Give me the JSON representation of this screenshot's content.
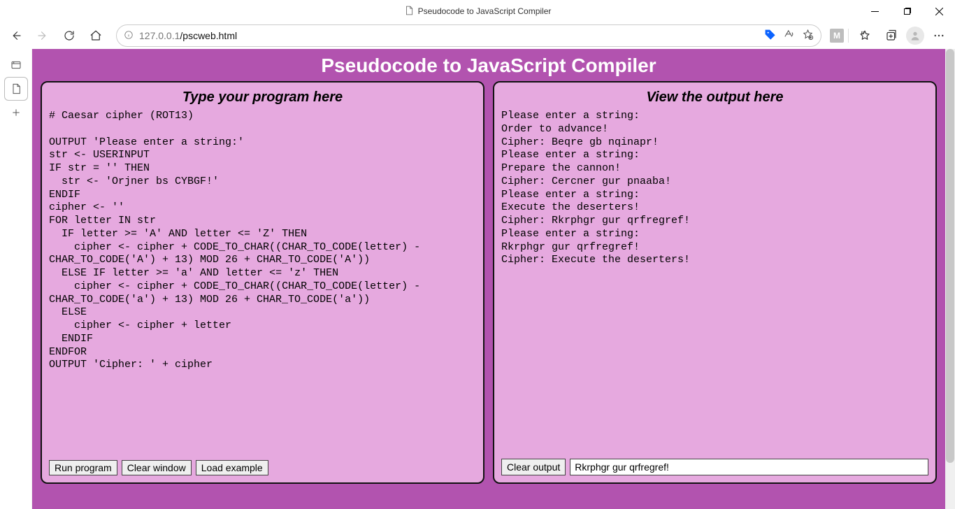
{
  "window": {
    "title": "Pseudocode to JavaScript Compiler"
  },
  "address": {
    "host": "127.0.0.1",
    "path": "/pscweb.html"
  },
  "ext_badge": "M",
  "app": {
    "title": "Pseudocode to JavaScript Compiler",
    "editor": {
      "heading": "Type your program here",
      "code": "# Caesar cipher (ROT13)\n\nOUTPUT 'Please enter a string:'\nstr <- USERINPUT\nIF str = '' THEN\n  str <- 'Orjner bs CYBGF!'\nENDIF\ncipher <- ''\nFOR letter IN str\n  IF letter >= 'A' AND letter <= 'Z' THEN\n    cipher <- cipher + CODE_TO_CHAR((CHAR_TO_CODE(letter) - CHAR_TO_CODE('A') + 13) MOD 26 + CHAR_TO_CODE('A'))\n  ELSE IF letter >= 'a' AND letter <= 'z' THEN\n    cipher <- cipher + CODE_TO_CHAR((CHAR_TO_CODE(letter) - CHAR_TO_CODE('a') + 13) MOD 26 + CHAR_TO_CODE('a'))\n  ELSE\n    cipher <- cipher + letter\n  ENDIF\nENDFOR\nOUTPUT 'Cipher: ' + cipher",
      "buttons": {
        "run": "Run program",
        "clear": "Clear window",
        "load": "Load example"
      }
    },
    "output": {
      "heading": "View the output here",
      "text": "Please enter a string:\nOrder to advance!\nCipher: Beqre gb nqinapr!\nPlease enter a string:\nPrepare the cannon!\nCipher: Cercner gur pnaaba!\nPlease enter a string:\nExecute the deserters!\nCipher: Rkrphgr gur qrfregref!\nPlease enter a string:\nRkrphgr gur qrfregref!\nCipher: Execute the deserters!",
      "buttons": {
        "clear": "Clear output"
      },
      "input_value": "Rkrphgr gur qrfregref!"
    }
  }
}
